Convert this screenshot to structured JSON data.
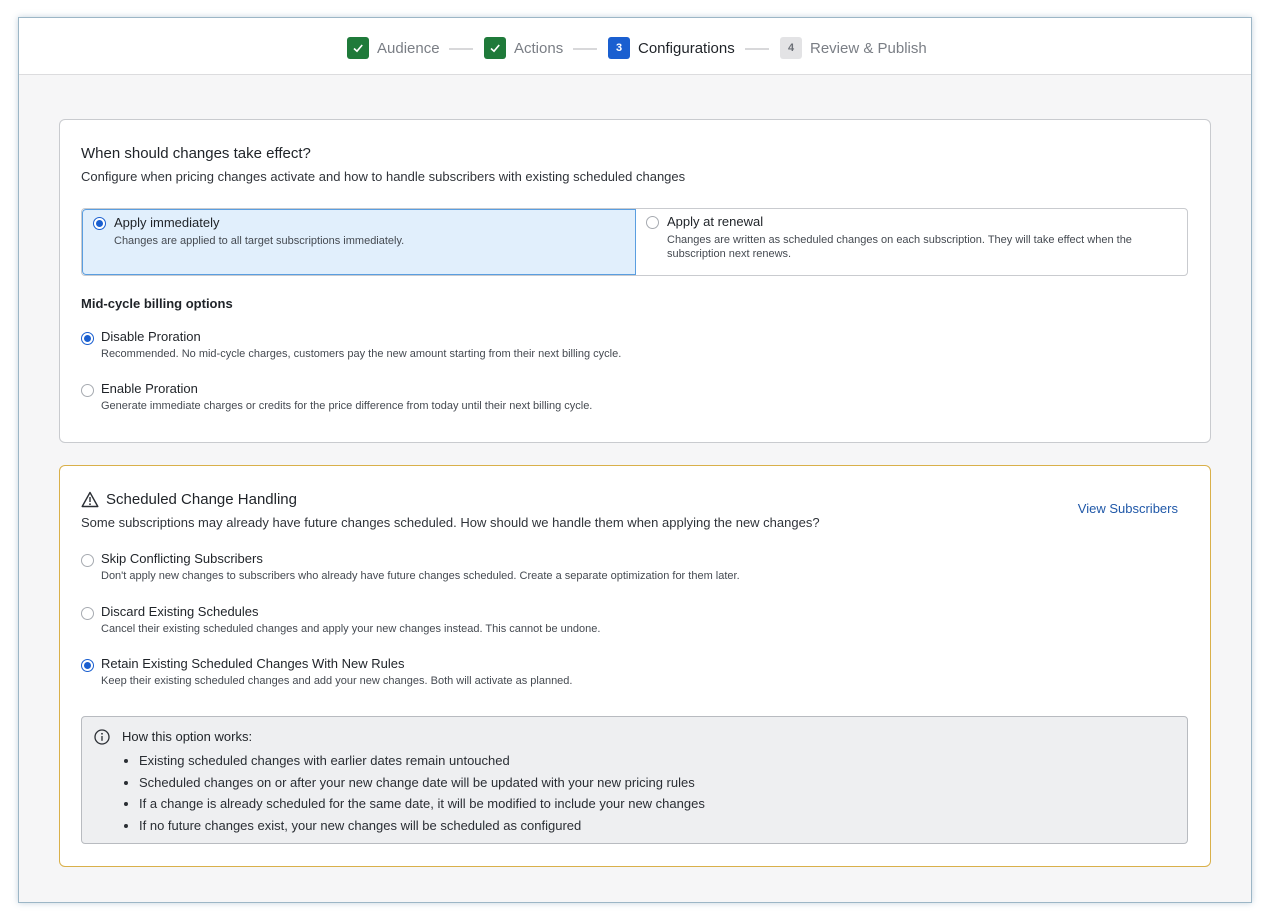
{
  "stepper": {
    "steps": [
      {
        "label": "Audience",
        "badge": "",
        "state": "done"
      },
      {
        "label": "Actions",
        "badge": "",
        "state": "done"
      },
      {
        "label": "Configurations",
        "badge": "3",
        "state": "active"
      },
      {
        "label": "Review & Publish",
        "badge": "4",
        "state": "todo"
      }
    ]
  },
  "effect": {
    "title": "When should changes take effect?",
    "subtitle": "Configure when pricing changes activate and how to handle subscribers with existing scheduled changes",
    "timing_options": [
      {
        "label": "Apply immediately",
        "desc": "Changes are applied to all target subscriptions immediately.",
        "selected": true
      },
      {
        "label": "Apply at renewal",
        "desc": "Changes are written as scheduled changes on each subscription. They will take effect when the subscription next renews.",
        "selected": false
      }
    ],
    "midcycle": {
      "title": "Mid-cycle billing options",
      "options": [
        {
          "label": "Disable Proration",
          "desc": "Recommended. No mid-cycle charges, customers pay the new amount starting from their next billing cycle.",
          "selected": true
        },
        {
          "label": "Enable Proration",
          "desc": "Generate immediate charges or credits for the price difference from today until their next billing cycle.",
          "selected": false
        }
      ]
    }
  },
  "scheduled": {
    "title": "Scheduled Change Handling",
    "subtitle": "Some subscriptions may already have future changes scheduled. How should we handle them when applying the new changes?",
    "view_link": "View Subscribers",
    "options": [
      {
        "label": "Skip Conflicting Subscribers",
        "desc": "Don't apply new changes to subscribers who already have future changes scheduled. Create a separate optimization for them later.",
        "selected": false
      },
      {
        "label": "Discard Existing Schedules",
        "desc": "Cancel their existing scheduled changes and apply your new changes instead. This cannot be undone.",
        "selected": false
      },
      {
        "label": "Retain Existing Scheduled Changes With New Rules",
        "desc": "Keep their existing scheduled changes and add your new changes. Both will activate as planned.",
        "selected": true
      }
    ],
    "info": {
      "title": "How this option works:",
      "items": [
        "Existing scheduled changes with earlier dates remain untouched",
        "Scheduled changes on or after your new change date will be updated with your new pricing rules",
        "If a change is already scheduled for the same date, it will be modified to include your new changes",
        "If no future changes exist, your new changes will be scheduled as configured"
      ]
    }
  },
  "colors": {
    "done": "#1f7a3a",
    "active": "#1a5fd0",
    "warning_border": "#d9b04a",
    "selected_bg": "#e1effc"
  }
}
